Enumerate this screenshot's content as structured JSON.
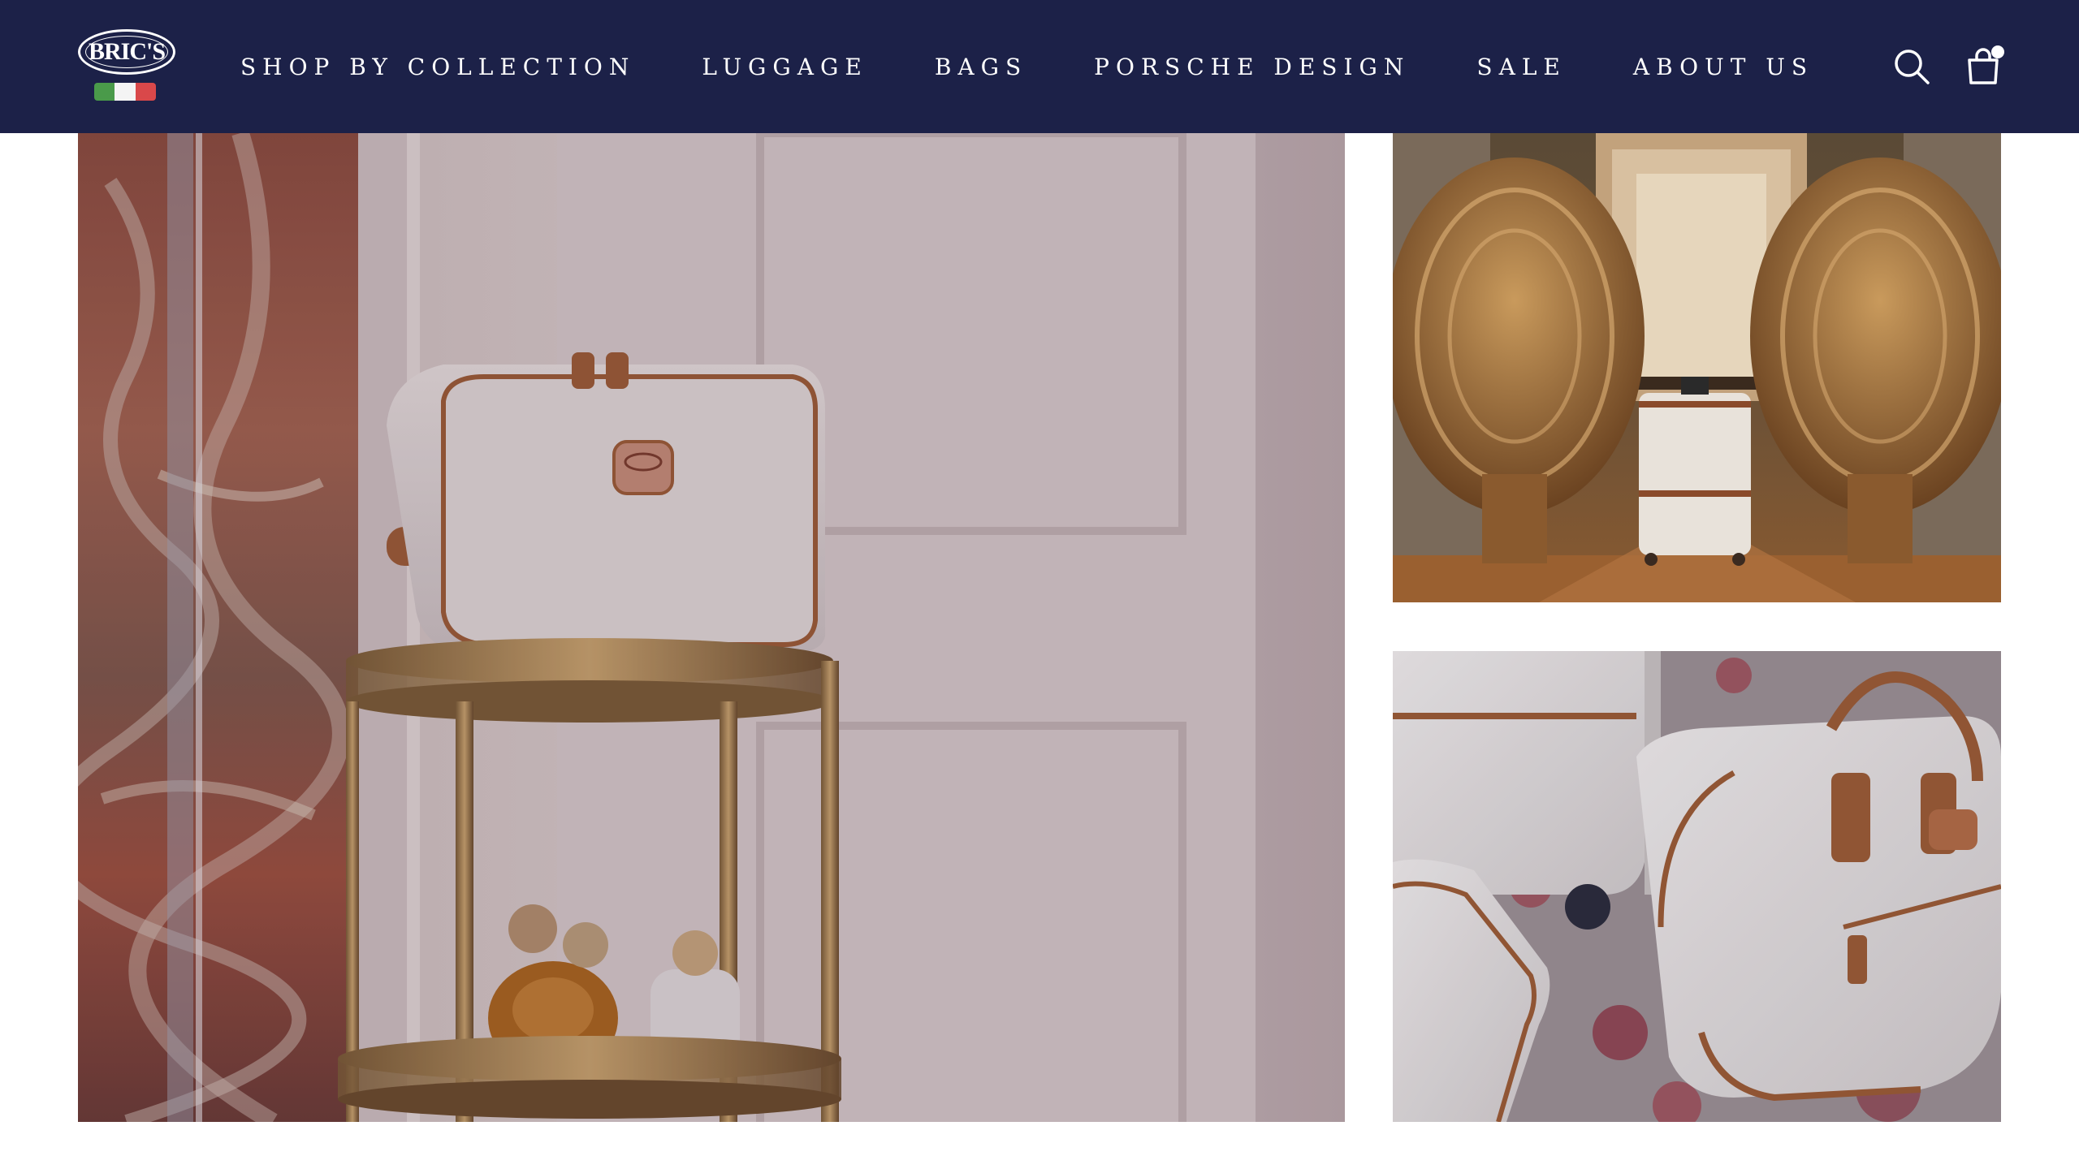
{
  "brand": {
    "logo_text": "BRIC'S",
    "flag_colors": [
      "#4a9a4a",
      "#f4f4f4",
      "#d9484a"
    ]
  },
  "nav": {
    "items": [
      {
        "label": "SHOP BY COLLECTION"
      },
      {
        "label": "LUGGAGE"
      },
      {
        "label": "BAGS"
      },
      {
        "label": "PORSCHE DESIGN"
      },
      {
        "label": "SALE"
      },
      {
        "label": "ABOUT US"
      }
    ],
    "icons": [
      "search-icon",
      "shopping-bag-icon"
    ]
  },
  "colors": {
    "navbar": "#1c2148",
    "accent_leather": "#9a5a34",
    "page_background": "#ffffff"
  },
  "gallery": {
    "images": [
      {
        "name": "toiletry-bag-on-brass-trolley"
      },
      {
        "name": "trolley-suitcase-among-wicker-chairs"
      },
      {
        "name": "white-duffel-and-luggage-on-rug"
      }
    ]
  }
}
